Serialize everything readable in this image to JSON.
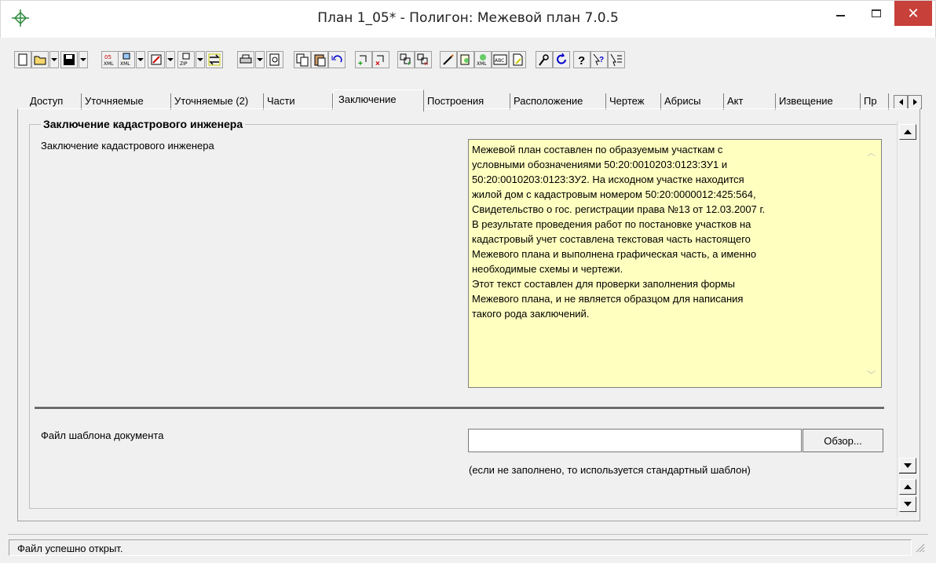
{
  "window": {
    "title": "План 1_05* - Полигон: Межевой план 7.0.5",
    "close_glyph": "✕"
  },
  "toolbar": {
    "icons": [
      "new-document-icon",
      "open-folder-icon",
      "save-icon",
      "export-xml-05-icon",
      "xml-icon",
      "edit-icon",
      "zip-icon",
      "exchange-icon",
      "print-icon",
      "print-preview-icon",
      "copy-icon",
      "paste-icon",
      "undo-icon",
      "add-point-icon",
      "delete-point-icon",
      "add-contour-icon",
      "delete-contour-icon",
      "pen-icon",
      "copy-object-icon",
      "xml-object-icon",
      "spell-check-icon",
      "document-icon",
      "settings-icon",
      "refresh-icon",
      "help-icon",
      "context-help-icon",
      "pointer-icon"
    ]
  },
  "tabs": [
    {
      "label": "Доступ"
    },
    {
      "label": "Уточняемые"
    },
    {
      "label": "Уточняемые (2)"
    },
    {
      "label": "Части"
    },
    {
      "label": "Заключение",
      "active": true
    },
    {
      "label": "Построения"
    },
    {
      "label": "Расположение"
    },
    {
      "label": "Чертеж"
    },
    {
      "label": "Абрисы"
    },
    {
      "label": "Акт"
    },
    {
      "label": "Извещение"
    },
    {
      "label": "Пр"
    }
  ],
  "section": {
    "group_title": "Заключение кадастрового инженера",
    "conclusion_label": "Заключение кадастрового инженера",
    "conclusion_text": "Межевой план составлен по образуемым участкам с\nусловными обозначениями 50:20:0010203:0123:ЗУ1 и\n50:20:0010203:0123:ЗУ2. На исходном участке находится\nжилой дом с кадастровым номером 50:20:0000012:425:564,\nСвидетельство о гос. регистрации права №13 от 12.03.2007 г.\nВ результате проведения работ по постановке участков на\nкадастровый учет составлена текстовая часть настоящего\nМежевого плана и выполнена графическая часть, а именно\nнеобходимые схемы и чертежи.\nЭтот текст составлен для проверки заполнения формы\nМежевого плана, и не является образцом для написания\nтакого рода заключений.",
    "template_label": "Файл шаблона документа",
    "template_value": "",
    "browse_label": "Обзор...",
    "template_hint": "(если не заполнено, то используется стандартный шаблон)"
  },
  "status": {
    "text": "Файл успешно открыт."
  },
  "colors": {
    "close_button": "#c7403a",
    "textarea_bg": "#ffffc0"
  }
}
